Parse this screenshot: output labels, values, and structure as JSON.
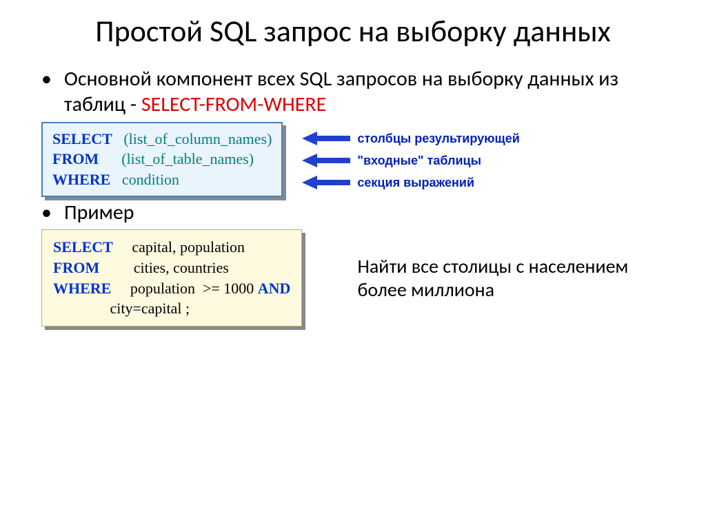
{
  "title": "Простой SQL запрос на выборку данных",
  "bullets": {
    "main": {
      "text_part1": "Основной компонент всех SQL запросов на выборку данных из таблиц - ",
      "text_red": "SELECT-FROM-WHERE"
    },
    "example_label": "Пример"
  },
  "sql_template": {
    "select_kw": "SELECT",
    "select_val": "(list_of_column_names)",
    "from_kw": "FROM",
    "from_val": "(list_of_table_names)",
    "where_kw": "WHERE",
    "where_val": "condition"
  },
  "arrows": {
    "a1": "столбцы результирующей",
    "a2": "\"входные\" таблицы",
    "a3": "секция выражений"
  },
  "sql_example": {
    "select_kw": "SELECT",
    "select_val": "capital, population",
    "from_kw": "FROM",
    "from_val": "cities, countries",
    "where_kw": "WHERE",
    "where_val1": "population  >= 1000 ",
    "and_kw": "AND",
    "where_val2": "city=capital ;"
  },
  "example_description": "Найти все столицы с населением более миллиона"
}
